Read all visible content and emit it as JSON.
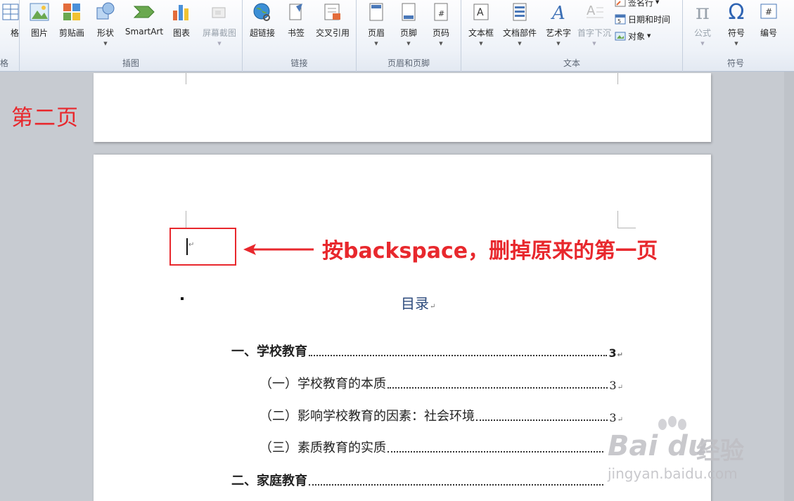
{
  "ribbon": {
    "partial_left": {
      "top": "格",
      "bottom": "格"
    },
    "groups": {
      "illustrations": {
        "label": "插图",
        "buttons": [
          "图片",
          "剪贴画",
          "形状",
          "SmartArt",
          "图表",
          "屏幕截图"
        ]
      },
      "links": {
        "label": "链接",
        "buttons": [
          "超链接",
          "书签",
          "交叉引用"
        ]
      },
      "header_footer": {
        "label": "页眉和页脚",
        "buttons": [
          "页眉",
          "页脚",
          "页码"
        ]
      },
      "text": {
        "label": "文本",
        "buttons": [
          "文本框",
          "文档部件",
          "艺术字",
          "首字下沉"
        ],
        "small": [
          "签名行",
          "日期和时间",
          "对象"
        ]
      },
      "symbols": {
        "label": "符号",
        "buttons": [
          "公式",
          "符号",
          "编号"
        ],
        "glyphs": [
          "π",
          "Ω",
          "#"
        ]
      }
    }
  },
  "document": {
    "page_label": "第二页",
    "annotation": "按backspace，删掉原来的第一页",
    "return_mark": "↵",
    "toc": {
      "title": "目录",
      "entries": [
        {
          "text": "一、学校教育",
          "page": "3",
          "level": 1
        },
        {
          "text": "（一）学校教育的本质",
          "page": "3",
          "level": 2
        },
        {
          "text": "（二）影响学校教育的因素：社会环境",
          "page": "3",
          "level": 2
        },
        {
          "text": "（三）素质教育的实质",
          "page": "",
          "level": 2
        },
        {
          "text": "二、家庭教育",
          "page": "",
          "level": 1
        }
      ]
    }
  },
  "watermark": {
    "brand": "Bai",
    "brand2": "du",
    "cn": "经验",
    "url": "jingyan.baidu.com"
  },
  "colors": {
    "annotation_red": "#e8282d",
    "toc_title_blue": "#2c4a7c"
  }
}
